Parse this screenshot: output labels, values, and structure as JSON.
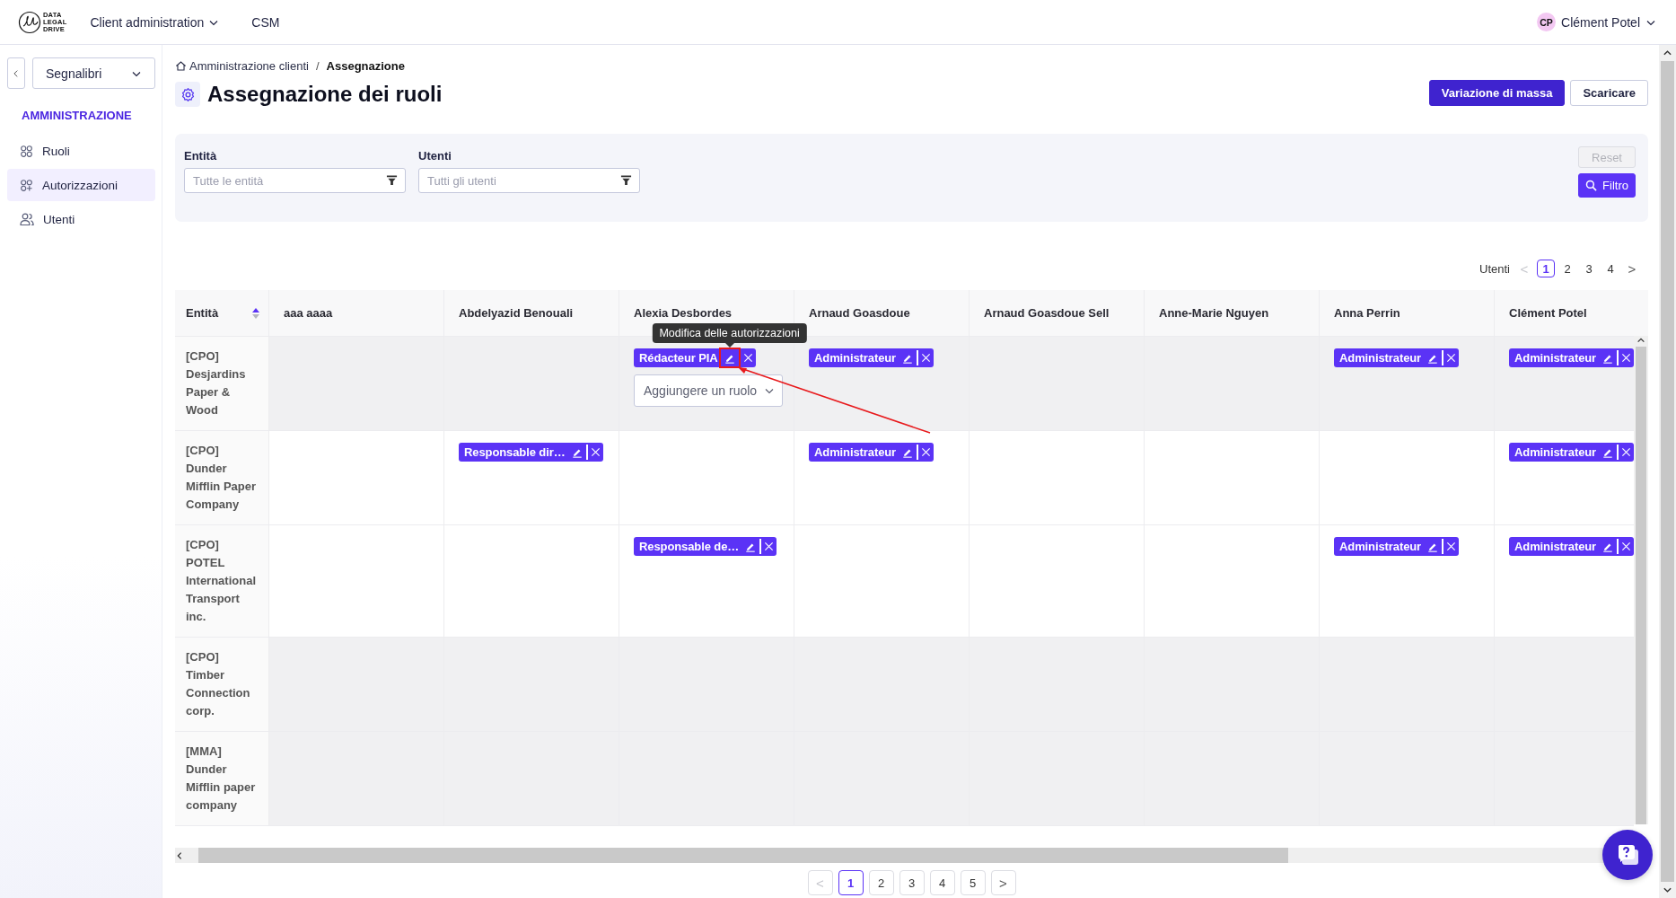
{
  "topbar": {
    "logo": [
      "DATA",
      "LEGAL",
      "DRIVE"
    ],
    "nav": [
      {
        "label": "Client administration",
        "dropdown": true
      },
      {
        "label": "CSM",
        "dropdown": false
      }
    ],
    "user": {
      "initials": "CP",
      "name": "Clément Potel"
    }
  },
  "sidebar": {
    "bookmarks": "Segnalibri",
    "section": "AMMINISTRAZIONE",
    "items": [
      {
        "label": "Ruoli",
        "kind": "grid",
        "selected": false
      },
      {
        "label": "Autorizzazioni",
        "kind": "grid-plus",
        "selected": true
      },
      {
        "label": "Utenti",
        "kind": "users",
        "selected": false
      }
    ]
  },
  "breadcrumb": [
    {
      "label": "Amministrazione clienti",
      "kind": "home"
    },
    {
      "label": "Assegnazione",
      "kind": "current"
    }
  ],
  "breadcrumb_separator": "/",
  "title": "Assegnazione dei ruoli",
  "actions": [
    {
      "label": "Variazione di massa",
      "kind": "primary"
    },
    {
      "label": "Scaricare",
      "kind": "secondary"
    }
  ],
  "filters": {
    "fields": [
      {
        "label": "Entità",
        "placeholder": "Tutte le entità"
      },
      {
        "label": "Utenti",
        "placeholder": "Tutti gli utenti"
      }
    ],
    "buttons": [
      {
        "label": "Reset",
        "kind": "secondary",
        "disabled": true
      },
      {
        "label": "Filtro",
        "kind": "primary",
        "disabled": false
      }
    ]
  },
  "user_pagination": {
    "label": "Utenti",
    "pages": [
      {
        "label": "<",
        "kind": "prev",
        "disabled": true,
        "selected": false
      },
      {
        "label": "1",
        "kind": "page",
        "disabled": false,
        "selected": true
      },
      {
        "label": "2",
        "kind": "page",
        "disabled": false,
        "selected": false
      },
      {
        "label": "3",
        "kind": "page",
        "disabled": false,
        "selected": false
      },
      {
        "label": "4",
        "kind": "page",
        "disabled": false,
        "selected": false
      },
      {
        "label": ">",
        "kind": "next",
        "disabled": false,
        "selected": false
      }
    ]
  },
  "table": {
    "entity_column": {
      "label": "Entità",
      "sortable": true
    },
    "columns": [
      {
        "label": "aaa aaaa",
        "sortable": false
      },
      {
        "label": "Abdelyazid Benouali",
        "sortable": false
      },
      {
        "label": "Alexia Desbordes",
        "sortable": false
      },
      {
        "label": "Arnaud Goasdoue",
        "sortable": false
      },
      {
        "label": "Arnaud Goasdoue Sell",
        "sortable": false
      },
      {
        "label": "Anne-Marie Nguyen",
        "sortable": false
      },
      {
        "label": "Anna Perrin",
        "sortable": false
      },
      {
        "label": "Clément Potel",
        "sortable": false
      }
    ],
    "rows": [
      {
        "entity": "[CPO] Desjardins Paper & Wood",
        "shaded": true,
        "cells": [
          {},
          {},
          {
            "roles": [
              {
                "label": "Rédacteur PIA",
                "highlighted": true,
                "tooltip": "Modifica delle autorizzazioni"
              }
            ],
            "add_role": "Aggiungere un ruolo"
          },
          {
            "roles": [
              {
                "label": "Administrateur",
                "highlighted": false
              }
            ]
          },
          {},
          {},
          {
            "roles": [
              {
                "label": "Administrateur",
                "highlighted": false
              }
            ]
          },
          {
            "roles": [
              {
                "label": "Administrateur",
                "highlighted": false
              }
            ]
          }
        ]
      },
      {
        "entity": "[CPO] Dunder Mifflin Paper Company",
        "shaded": false,
        "cells": [
          {},
          {
            "roles": [
              {
                "label": "Responsable dir…",
                "highlighted": false
              }
            ]
          },
          {},
          {
            "roles": [
              {
                "label": "Administrateur",
                "highlighted": false
              }
            ]
          },
          {},
          {},
          {},
          {
            "roles": [
              {
                "label": "Administrateur",
                "highlighted": false
              }
            ]
          }
        ]
      },
      {
        "entity": "[CPO] POTEL International Transport inc.",
        "shaded": false,
        "cells": [
          {},
          {},
          {
            "roles": [
              {
                "label": "Responsable de…",
                "highlighted": false
              }
            ]
          },
          {},
          {},
          {},
          {
            "roles": [
              {
                "label": "Administrateur",
                "highlighted": false
              }
            ]
          },
          {
            "roles": [
              {
                "label": "Administrateur",
                "highlighted": false
              }
            ]
          }
        ]
      },
      {
        "entity": "[CPO] Timber Connection corp.",
        "shaded": true,
        "cells": [
          {},
          {},
          {},
          {},
          {},
          {},
          {},
          {}
        ]
      },
      {
        "entity": "[MMA] Dunder Mifflin paper company",
        "shaded": true,
        "cells": [
          {},
          {},
          {},
          {},
          {},
          {},
          {},
          {}
        ]
      }
    ]
  },
  "pagination": {
    "pages": [
      {
        "label": "<",
        "kind": "prev",
        "disabled": true,
        "selected": false
      },
      {
        "label": "1",
        "kind": "page",
        "disabled": false,
        "selected": true
      },
      {
        "label": "2",
        "kind": "page",
        "disabled": false,
        "selected": false
      },
      {
        "label": "3",
        "kind": "page",
        "disabled": false,
        "selected": false
      },
      {
        "label": "4",
        "kind": "page",
        "disabled": false,
        "selected": false
      },
      {
        "label": "5",
        "kind": "page",
        "disabled": false,
        "selected": false
      },
      {
        "label": ">",
        "kind": "next",
        "disabled": false,
        "selected": false
      }
    ]
  }
}
